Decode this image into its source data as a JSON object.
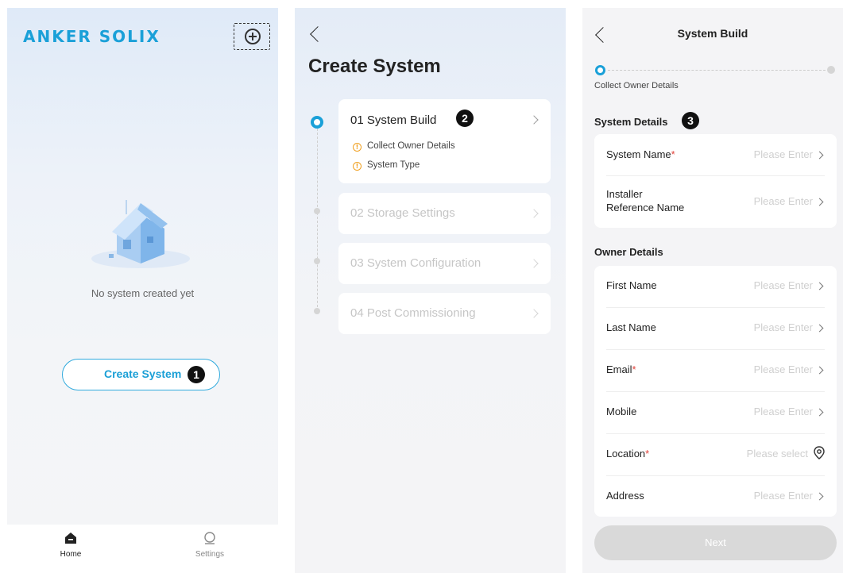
{
  "home": {
    "logo": "ANKER SOLIX",
    "add_icon": "add-circle-icon",
    "empty_text": "No system created yet",
    "create_button": "Create System",
    "badge": "1",
    "tabs": [
      {
        "label": "Home",
        "icon": "home-icon"
      },
      {
        "label": "Settings",
        "icon": "settings-icon"
      }
    ]
  },
  "create": {
    "title": "Create System",
    "badge": "2",
    "steps": [
      {
        "label": "01 System Build",
        "subitems": [
          "Collect Owner Details",
          "System Type"
        ]
      },
      {
        "label": "02 Storage Settings"
      },
      {
        "label": "03 System Configuration"
      },
      {
        "label": "04 Post Commissioning"
      }
    ]
  },
  "build": {
    "title": "System Build",
    "progress_label": "Collect Owner Details",
    "badge": "3",
    "system_section": "System Details",
    "owner_section": "Owner Details",
    "system_fields": [
      {
        "label": "System Name",
        "required": "*",
        "placeholder": "Please Enter"
      },
      {
        "label": "Installer Reference Name",
        "line1": "Installer",
        "line2": "Reference Name",
        "placeholder": "Please Enter"
      }
    ],
    "owner_fields": [
      {
        "label": "First Name",
        "required": "",
        "placeholder": "Please Enter"
      },
      {
        "label": "Last Name",
        "required": "",
        "placeholder": "Please Enter"
      },
      {
        "label": "Email",
        "required": "*",
        "placeholder": "Please Enter"
      },
      {
        "label": "Mobile",
        "required": "",
        "placeholder": "Please Enter"
      },
      {
        "label": "Location",
        "required": "*",
        "placeholder": "Please select"
      },
      {
        "label": "Address",
        "required": "",
        "placeholder": "Please Enter"
      }
    ],
    "next_button": "Next"
  },
  "colors": {
    "accent": "#1aa0d8",
    "required": "#e0433b",
    "warning": "#f0a020"
  }
}
